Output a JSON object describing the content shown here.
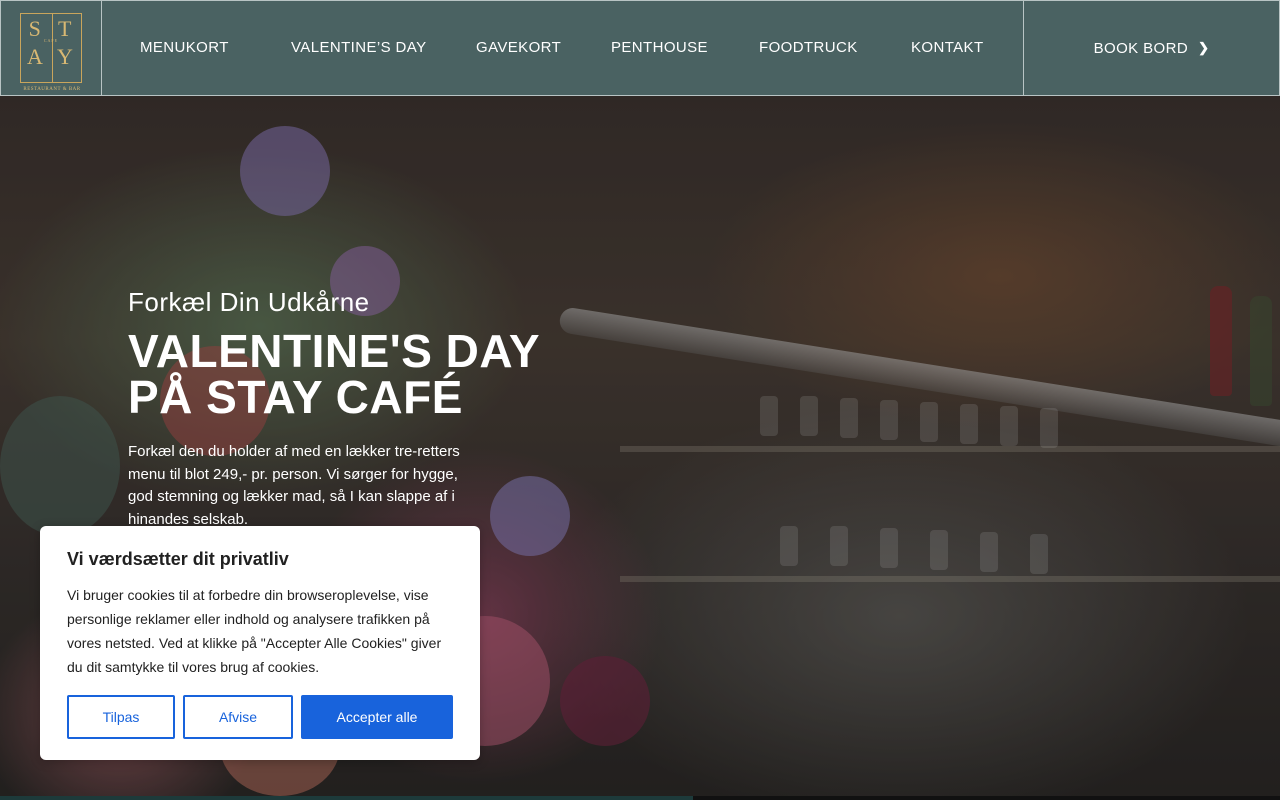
{
  "logo": {
    "letters_top": [
      "S",
      "T"
    ],
    "letters_bottom": [
      "A",
      "Y"
    ],
    "middle_text": "CAFE",
    "subtitle": "RESTAURANT & BAR"
  },
  "nav": {
    "items": [
      {
        "label": "MENUKORT"
      },
      {
        "label": "VALENTINE’S DAY"
      },
      {
        "label": "GAVEKORT"
      },
      {
        "label": "PENTHOUSE"
      },
      {
        "label": "FOODTRUCK"
      },
      {
        "label": "KONTAKT"
      }
    ],
    "book_label": "BOOK BORD",
    "book_icon": "chevron-right-icon"
  },
  "hero": {
    "eyebrow": "Forkæl Din Udkårne",
    "title_line1": "VALENTINE'S DAY",
    "title_line2": "PÅ STAY CAFÉ",
    "description": "Forkæl den du holder af med en lækker tre-retters menu til blot 249,- pr. person. Vi sørger for hygge, god stemning og lækker mad, så I kan slappe af i hinandes selskab."
  },
  "cookie_banner": {
    "title": "Vi værdsætter dit privatliv",
    "body": "Vi bruger cookies til at forbedre din browseroplevelse, vise personlige reklamer eller indhold og analysere trafikken på vores netsted. Ved at klikke på \"Accepter Alle Cookies\" giver du dit samtykke til vores brug af cookies.",
    "customize_label": "Tilpas",
    "reject_label": "Afvise",
    "accept_label": "Accepter alle"
  },
  "colors": {
    "header_bg": "#4a6262",
    "logo_gold": "#d8b873",
    "cookie_primary": "#1863dc"
  }
}
